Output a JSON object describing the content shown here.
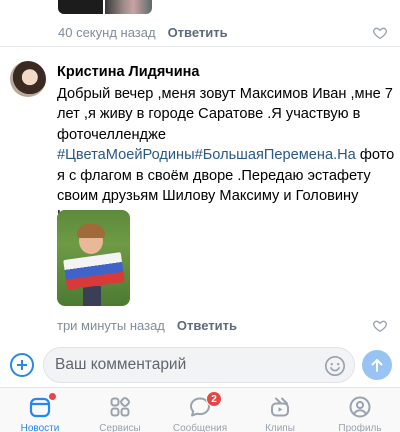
{
  "previous_comment": {
    "timestamp": "40 секунд назад",
    "reply_label": "Ответить"
  },
  "comment": {
    "author": "Кристина Лидячина",
    "text_before": "Добрый вечер ,меня зовут Максимов Иван ,мне 7 лет ,я живу в городе Саратове .Я участвую в фоточеллендже ",
    "hashtags": "#ЦветаМоейРодины#БольшаяПеремена.На",
    "text_after": " фото я с флагом в своём дворе .Передаю эстафету своим друзьям Шилову Максиму и Головину Кириллу.",
    "timestamp": "три минуты назад",
    "reply_label": "Ответить"
  },
  "input_bar": {
    "placeholder": "Ваш комментарий"
  },
  "tabbar": {
    "tabs": [
      {
        "label": "Новости",
        "icon": "news-icon",
        "active": true,
        "dot": true
      },
      {
        "label": "Сервисы",
        "icon": "services-icon",
        "active": false
      },
      {
        "label": "Сообщения",
        "icon": "messages-icon",
        "active": false,
        "badge": "2"
      },
      {
        "label": "Клипы",
        "icon": "clips-icon",
        "active": false
      },
      {
        "label": "Профиль",
        "icon": "profile-icon",
        "active": false
      }
    ]
  },
  "colors": {
    "accent": "#2688eb",
    "link": "#2a5885",
    "secondary_text": "#818c99",
    "badge": "#e64646"
  }
}
